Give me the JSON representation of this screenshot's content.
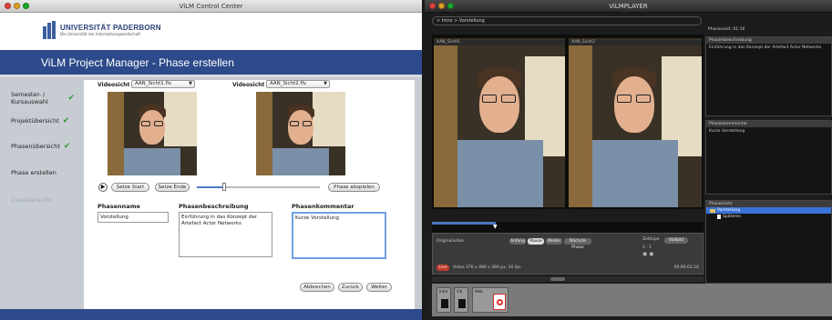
{
  "left_window": {
    "title": "ViLM Control Center",
    "university": {
      "name": "UNIVERSITÄT PADERBORN",
      "tagline": "Die Universität der Informationsgesellschaft"
    },
    "page_title": "ViLM Project Manager - Phase erstellen",
    "nav": [
      {
        "label": "Semester- / Kursauswahl",
        "done": true,
        "check": "✔"
      },
      {
        "label": "Projektübersicht",
        "done": true,
        "check": "✔"
      },
      {
        "label": "Phasenübersicht",
        "done": true,
        "check": "✔"
      },
      {
        "label": "Phase erstellen",
        "done": false,
        "check": ""
      },
      {
        "label": "Zusatzansicht",
        "done": false,
        "check": ""
      }
    ],
    "video1": {
      "label": "Videosicht",
      "selected": "AAN_Sicht1.flv"
    },
    "video2": {
      "label": "Videosicht",
      "selected": "AAN_Sicht2.flv"
    },
    "controls": {
      "play_icon": "▶",
      "start_label": "Setze Start",
      "end_label": "Setze Ende",
      "preview_label": "Phase abspielen"
    },
    "form": {
      "name_label": "Phasenname",
      "name_value": "Vorstellung",
      "desc_label": "Phasenbeschreibung",
      "desc_value": "Einführung in das Konzept der Artefact Actor Networks",
      "comment_label": "Phasenkommentar",
      "comment_value": "Kurze Vorstellung"
    },
    "footer_buttons": {
      "cancel": "Abbrechen",
      "back": "Zurück",
      "next": "Weiter"
    }
  },
  "right_window": {
    "title": "ViLMPLAYER",
    "breadcrumb": "> Intro > Vorstellung",
    "video_titles": [
      "AAN_Sicht1",
      "AAN_Sicht2"
    ],
    "control": {
      "label": "Originalvideo",
      "pills": [
        "Anfang",
        "Pause",
        "Weiter",
        "Nächste Phase"
      ],
      "right_label": "Zeitlupe",
      "right_pill": "Vollbild",
      "ratio": "1 : 1",
      "rec_label": "Live",
      "info": "Video 376 x 480 x 384 px, 30 fps",
      "timecode": "00:00:01:16"
    },
    "thumbs": [
      "Intro",
      "Vid",
      "Web"
    ],
    "panels": {
      "top_header": "Phasenzeit: 01:16",
      "desc_header": "Phasenbeschreibung",
      "desc_text": "Einführung in das Konzept der Artefact Actor Networks",
      "comment_header": "Phasenkommentar",
      "comment_text": "Kurze Vorstellung",
      "tree_header": "Phasenliste",
      "tree": [
        "Vorstellung",
        "Späteres"
      ]
    }
  },
  "colors": {
    "brand_blue": "#2d4a8a",
    "check_green": "#2e9a2e",
    "select_blue": "#3a73d8"
  }
}
